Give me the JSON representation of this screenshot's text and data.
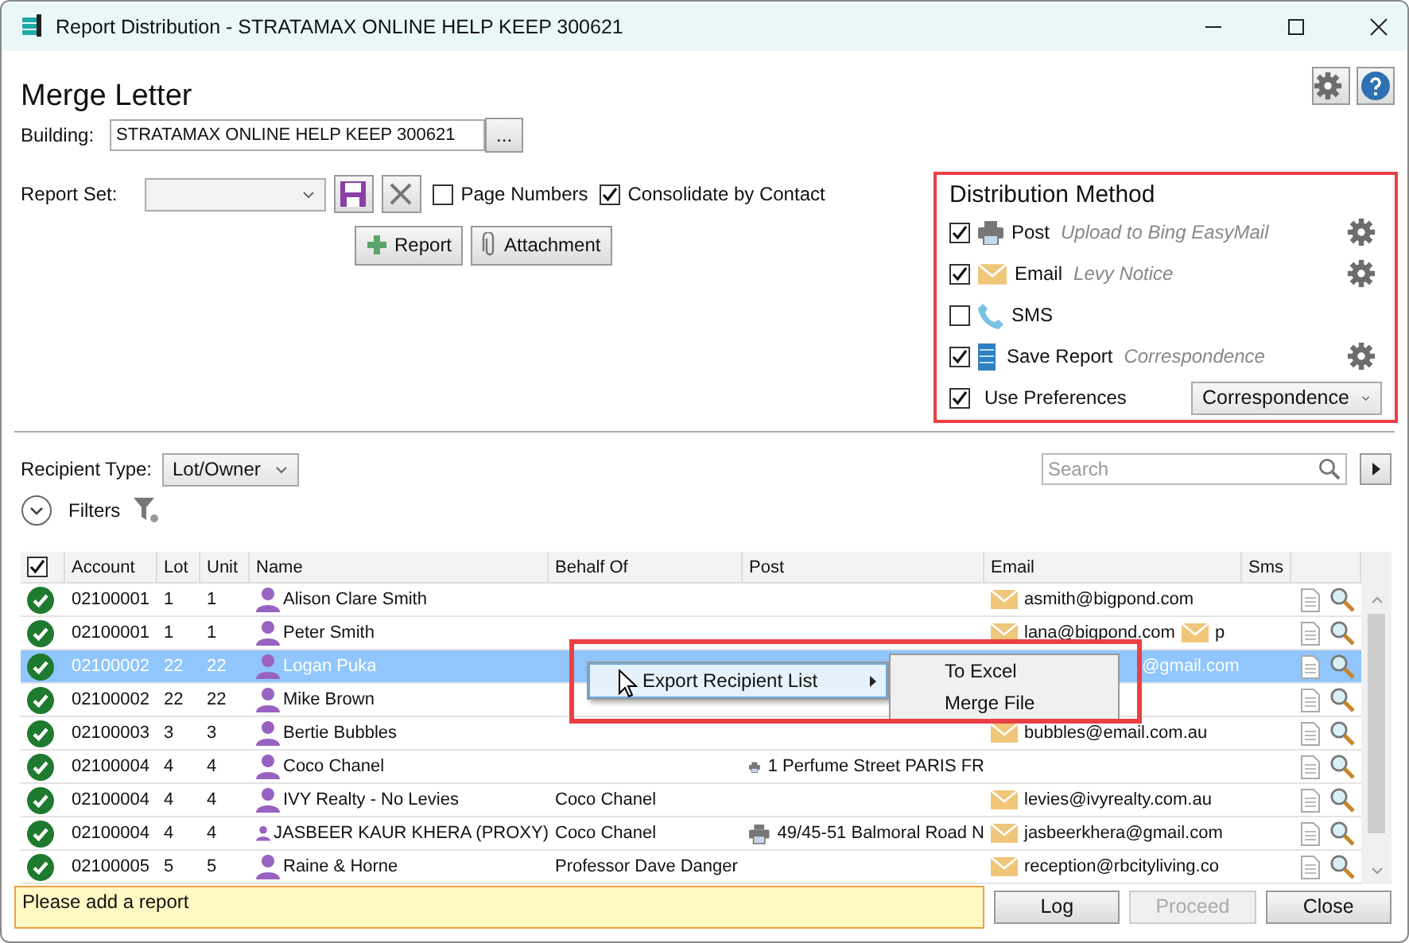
{
  "window": {
    "title": "Report Distribution - STRATAMAX ONLINE HELP KEEP 300621"
  },
  "header": {
    "title": "Merge Letter"
  },
  "building": {
    "label": "Building:",
    "value": "STRATAMAX ONLINE HELP KEEP 300621",
    "browse": "..."
  },
  "report_set": {
    "label": "Report Set:"
  },
  "options": [
    {
      "label": "Page Numbers",
      "checked": false
    },
    {
      "label": "Consolidate by Contact",
      "checked": true
    }
  ],
  "add_buttons": [
    {
      "kind": "plus",
      "label": "Report"
    },
    {
      "kind": "clip",
      "label": "Attachment"
    }
  ],
  "distribution": {
    "title": "Distribution Method",
    "methods": [
      {
        "kind": "post",
        "label": "Post",
        "detail": "Upload to Bing EasyMail",
        "checked": true,
        "settings": true
      },
      {
        "kind": "email",
        "label": "Email",
        "detail": "Levy Notice",
        "checked": true,
        "settings": true
      },
      {
        "kind": "sms",
        "label": "SMS",
        "checked": false,
        "settings": false
      },
      {
        "kind": "save",
        "label": "Save Report",
        "detail": "Correspondence",
        "checked": true,
        "settings": true
      }
    ],
    "preferences": {
      "label": "Use Preferences",
      "checked": true,
      "value": "Correspondence"
    }
  },
  "recipient_type": {
    "label": "Recipient Type:",
    "value": "Lot/Owner"
  },
  "search": {
    "placeholder": "Search"
  },
  "filters": {
    "label": "Filters"
  },
  "table": {
    "all_checked": true,
    "columns": [
      "Account",
      "Lot",
      "Unit",
      "Name",
      "Behalf Of",
      "Post",
      "Email",
      "Sms"
    ],
    "rows": [
      {
        "selected": false,
        "account": "02100001",
        "lot": "1",
        "unit": "1",
        "name": "Alison Clare Smith",
        "emails": [
          {
            "text": "asmith@bigpond.com"
          }
        ]
      },
      {
        "selected": false,
        "account": "02100001",
        "lot": "1",
        "unit": "1",
        "name": "Peter Smith",
        "emails": [
          {
            "text": "lana@bigpond.com"
          },
          {
            "text": "p"
          }
        ]
      },
      {
        "selected": true,
        "account": "02100002",
        "lot": "22",
        "unit": "22",
        "name": "Logan Puka",
        "emails": [
          {
            "text": "@gmail.com",
            "cut": true
          }
        ]
      },
      {
        "selected": false,
        "account": "02100002",
        "lot": "22",
        "unit": "22",
        "name": "Mike Brown"
      },
      {
        "selected": false,
        "account": "02100003",
        "lot": "3",
        "unit": "3",
        "name": "Bertie Bubbles",
        "emails": [
          {
            "text": "bubbles@email.com.au"
          }
        ]
      },
      {
        "selected": false,
        "account": "02100004",
        "lot": "4",
        "unit": "4",
        "name": "Coco Chanel",
        "post": "1 Perfume Street PARIS FR"
      },
      {
        "selected": false,
        "account": "02100004",
        "lot": "4",
        "unit": "4",
        "name": "IVY Realty - No Levies",
        "behalf_of": "Coco Chanel",
        "emails": [
          {
            "text": "levies@ivyrealty.com.au"
          }
        ]
      },
      {
        "selected": false,
        "account": "02100004",
        "lot": "4",
        "unit": "4",
        "name": "JASBEER KAUR KHERA (PROXY)",
        "behalf_of": "Coco Chanel",
        "post": "49/45-51 Balmoral Road N",
        "emails": [
          {
            "text": "jasbeerkhera@gmail.com"
          }
        ]
      },
      {
        "selected": false,
        "account": "02100005",
        "lot": "5",
        "unit": "5",
        "name": "Raine & Horne",
        "behalf_of": "Professor Dave Danger",
        "emails": [
          {
            "text": "reception@rbcityliving.co"
          }
        ]
      }
    ]
  },
  "context_menu": {
    "items": [
      {
        "label": "Export Recipient List",
        "submenu": true
      }
    ],
    "submenu": [
      "To Excel",
      "Merge File"
    ]
  },
  "status": {
    "message": "Please add a report"
  },
  "footer_buttons": [
    {
      "label": "Log",
      "disabled": false
    },
    {
      "label": "Proceed",
      "disabled": true
    },
    {
      "label": "Close",
      "disabled": false
    }
  ]
}
